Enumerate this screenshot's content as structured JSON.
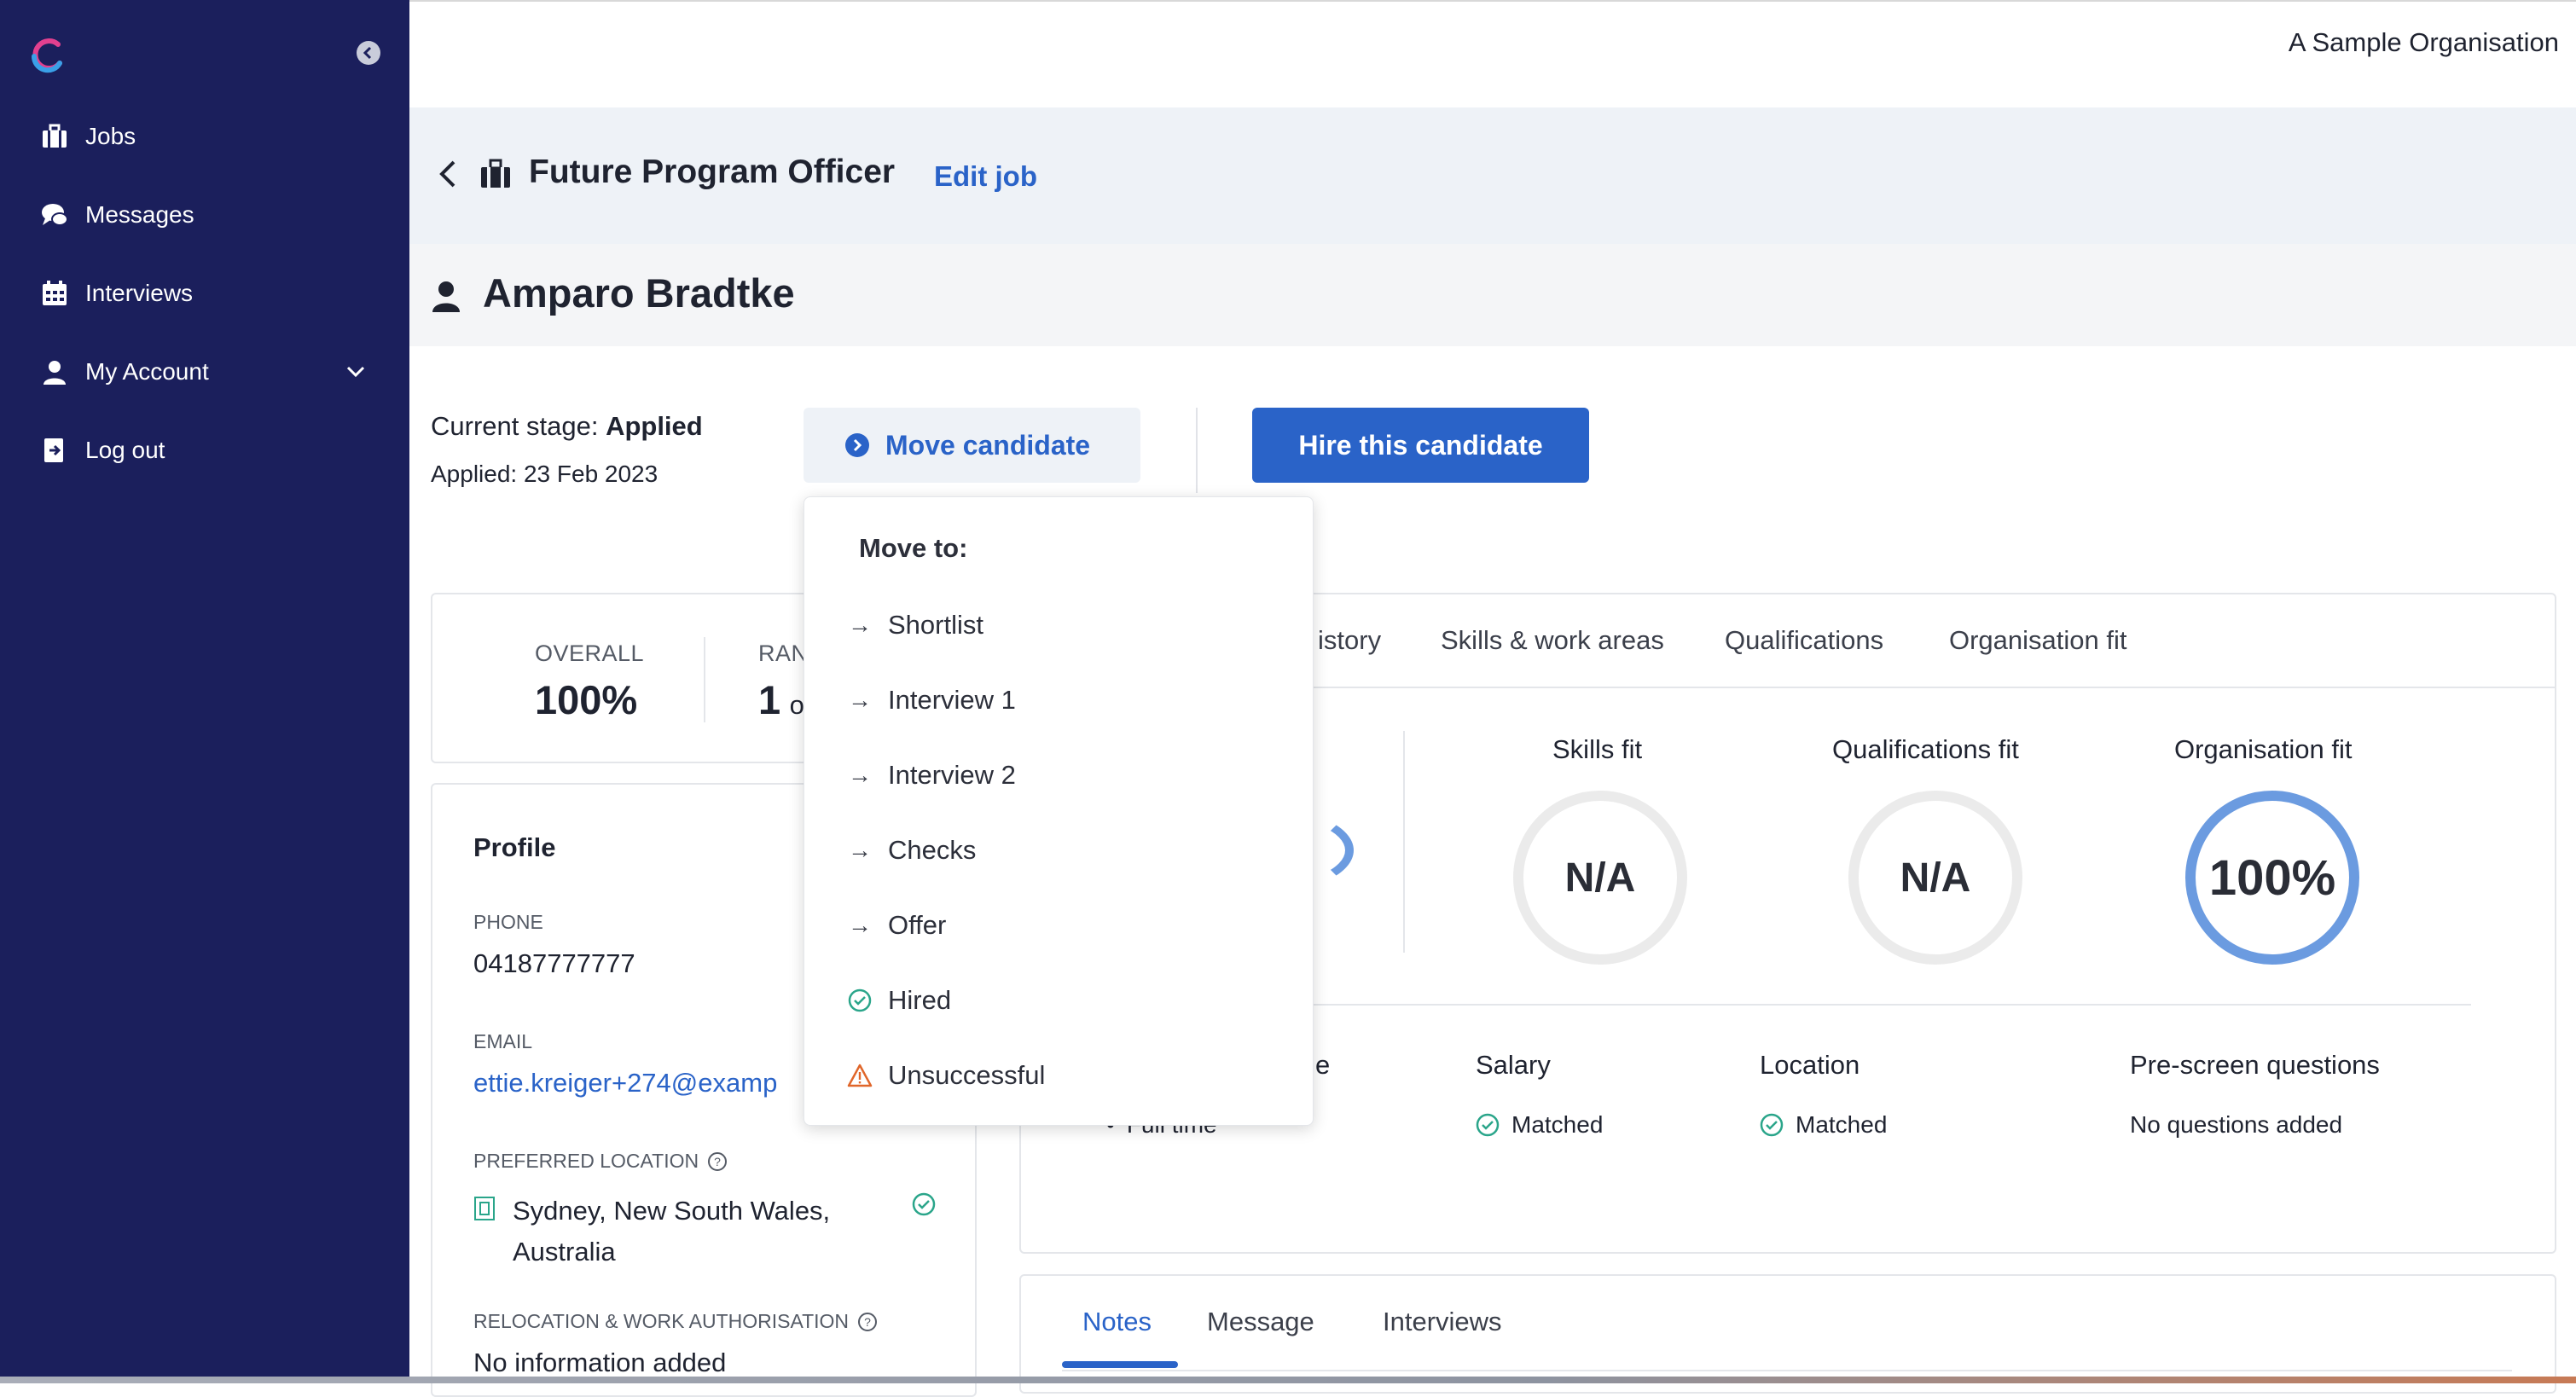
{
  "sidebar": {
    "items": [
      {
        "label": "Jobs",
        "icon": "briefcase-icon"
      },
      {
        "label": "Messages",
        "icon": "chat-icon"
      },
      {
        "label": "Interviews",
        "icon": "calendar-icon"
      },
      {
        "label": "My Account",
        "icon": "user-icon"
      },
      {
        "label": "Log out",
        "icon": "logout-icon"
      }
    ]
  },
  "header": {
    "organisation": "A Sample Organisation"
  },
  "job": {
    "title": "Future Program Officer",
    "edit_label": "Edit job"
  },
  "candidate": {
    "name": "Amparo Bradtke",
    "stage_label": "Current stage:",
    "stage_value": "Applied",
    "applied_text": "Applied: 23 Feb 2023"
  },
  "actions": {
    "move_label": "Move candidate",
    "hire_label": "Hire this candidate"
  },
  "scores": {
    "overall_label": "OVERALL",
    "overall_value": "100%",
    "rank_label": "RAN",
    "rank_value": "1",
    "rank_suffix": "o"
  },
  "profile": {
    "title": "Profile",
    "phone_label": "PHONE",
    "phone_value": "04187777777",
    "email_label": "EMAIL",
    "email_value": "ettie.kreiger+274@examp",
    "location_label": "PREFERRED LOCATION",
    "location_line1": "Sydney, New South Wales,",
    "location_line2": "Australia",
    "relocation_label": "RELOCATION & WORK AUTHORISATION",
    "relocation_value": "No information added"
  },
  "tabs": [
    {
      "label": "istory"
    },
    {
      "label": "Skills & work areas"
    },
    {
      "label": "Qualifications"
    },
    {
      "label": "Organisation fit"
    }
  ],
  "fits": [
    {
      "title": "Skills fit",
      "value": "N/A"
    },
    {
      "title": "Qualifications fit",
      "value": "N/A"
    },
    {
      "title": "Organisation fit",
      "value": "100%",
      "percent": 100
    }
  ],
  "criteria": [
    {
      "title": "e",
      "value": "Full time"
    },
    {
      "title": "Salary",
      "value": "Matched"
    },
    {
      "title": "Location",
      "value": "Matched"
    },
    {
      "title": "Pre-screen questions",
      "value": "No questions added"
    }
  ],
  "bottom_tabs": [
    {
      "label": "Notes",
      "active": true
    },
    {
      "label": "Message"
    },
    {
      "label": "Interviews"
    }
  ],
  "dropdown": {
    "header": "Move to:",
    "items": [
      {
        "label": "Shortlist",
        "icon": "arrow-right-icon"
      },
      {
        "label": "Interview 1",
        "icon": "arrow-right-icon"
      },
      {
        "label": "Interview 2",
        "icon": "arrow-right-icon"
      },
      {
        "label": "Checks",
        "icon": "arrow-right-icon"
      },
      {
        "label": "Offer",
        "icon": "arrow-right-icon"
      },
      {
        "label": "Hired",
        "icon": "check-circle-icon"
      },
      {
        "label": "Unsuccessful",
        "icon": "warning-icon"
      }
    ]
  },
  "colors": {
    "sidebar": "#1b1f5c",
    "accent": "#2a63c8",
    "ring_full": "#6b9be0",
    "success": "#2aa58a",
    "warning": "#e0662a"
  }
}
